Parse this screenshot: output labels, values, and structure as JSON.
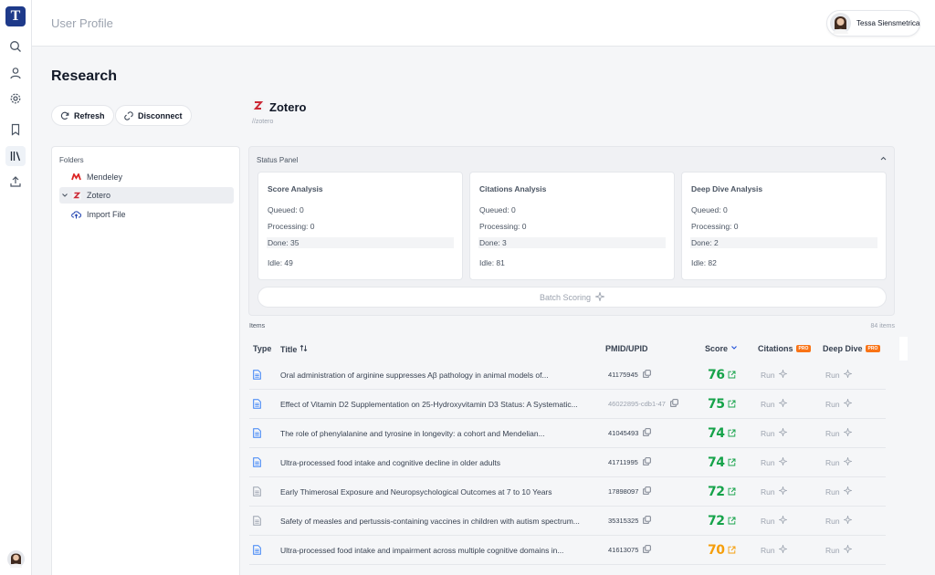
{
  "app": {
    "logo_letter": "T",
    "page_title": "User Profile"
  },
  "user": {
    "name": "Tessa Siensmetrica"
  },
  "colors": {
    "brand": "#1e3a8a",
    "score_green": "#16a34a",
    "score_orange": "#f59e0b",
    "pro_badge": "#f97316",
    "zotero_red": "#cc2936",
    "mendeley_red": "#dc2626",
    "doc_icon_blue": "#3b82f6",
    "doc_icon_gray": "#9ca3af"
  },
  "sidebar": {
    "icons": [
      "search-icon",
      "user-icon",
      "gear-icon",
      "bookmark-icon",
      "library-icon",
      "upload-icon"
    ],
    "active": "library-icon"
  },
  "main": {
    "heading": "Research",
    "refresh_label": "Refresh",
    "disconnect_label": "Disconnect"
  },
  "source": {
    "name": "Zotero",
    "path": "//zotero"
  },
  "folders": {
    "label": "Folders",
    "items": [
      {
        "label": "Mendeley",
        "icon": "mendeley-icon"
      },
      {
        "label": "Zotero",
        "icon": "zotero-icon",
        "selected": true
      },
      {
        "label": "Import File",
        "icon": "cloud-upload-icon"
      }
    ]
  },
  "status_panel": {
    "label": "Status Panel",
    "cards": [
      {
        "title": "Score Analysis",
        "queued": "Queued: 0",
        "processing": "Processing: 0",
        "done": "Done: 35",
        "idle": "Idle: 49"
      },
      {
        "title": "Citations Analysis",
        "queued": "Queued: 0",
        "processing": "Processing: 0",
        "done": "Done: 3",
        "idle": "Idle: 81"
      },
      {
        "title": "Deep Dive Analysis",
        "queued": "Queued: 0",
        "processing": "Processing: 0",
        "done": "Done: 2",
        "idle": "Idle: 82"
      }
    ],
    "batch_label": "Batch Scoring"
  },
  "items": {
    "label": "Items",
    "count": "84 items",
    "columns": {
      "type": "Type",
      "title": "Title",
      "pmid": "PMID/UPID",
      "score": "Score",
      "citations": "Citations",
      "deep_dive": "Deep Dive",
      "pro": "PRO"
    },
    "run_label": "Run",
    "rows": [
      {
        "title": "Oral administration of arginine suppresses Aβ pathology in animal models of...",
        "pmid": "41175945",
        "score": "76",
        "pmid_dim": false,
        "doc_color": "blue",
        "score_color": "green"
      },
      {
        "title": "Effect of Vitamin D2 Supplementation on 25-Hydroxyvitamin D3 Status: A Systematic...",
        "pmid": "46022895-cdb1-47",
        "score": "75",
        "pmid_dim": true,
        "doc_color": "blue",
        "score_color": "green"
      },
      {
        "title": "The role of phenylalanine and tyrosine in longevity: a cohort and Mendelian...",
        "pmid": "41045493",
        "score": "74",
        "pmid_dim": false,
        "doc_color": "blue",
        "score_color": "green"
      },
      {
        "title": "Ultra-processed food intake and cognitive decline in older adults",
        "pmid": "41711995",
        "score": "74",
        "pmid_dim": false,
        "doc_color": "blue",
        "score_color": "green"
      },
      {
        "title": "Early Thimerosal Exposure and Neuropsychological Outcomes at 7 to 10 Years",
        "pmid": "17898097",
        "score": "72",
        "pmid_dim": false,
        "doc_color": "gray",
        "score_color": "green"
      },
      {
        "title": "Safety of measles and pertussis-containing vaccines in children with autism spectrum...",
        "pmid": "35315325",
        "score": "72",
        "pmid_dim": false,
        "doc_color": "gray",
        "score_color": "green"
      },
      {
        "title": "Ultra-processed food intake and impairment across multiple cognitive domains in...",
        "pmid": "41613075",
        "score": "70",
        "pmid_dim": false,
        "doc_color": "blue",
        "score_color": "orange"
      }
    ]
  }
}
